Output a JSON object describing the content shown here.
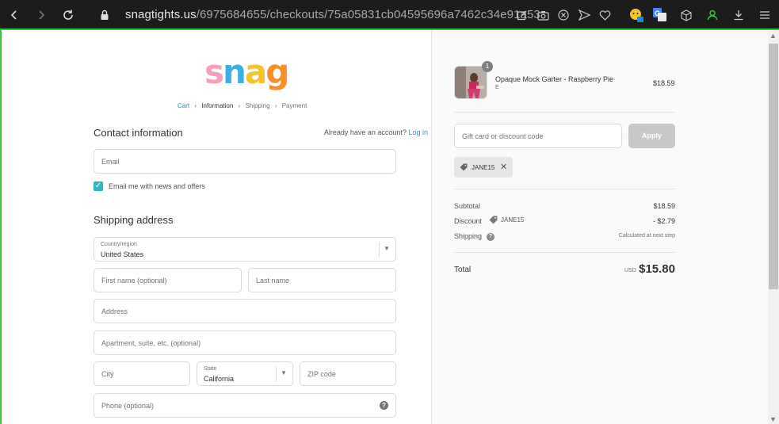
{
  "browser": {
    "url_domain": "snagtights.us",
    "url_path": "/6975684655/checkouts/75a05831cb04595696a7462c34e91a53",
    "extension_badge": "G",
    "accent_color": "#38c936"
  },
  "brand": {
    "logo_text": "snag",
    "logo_colors": [
      "#f59fbd",
      "#3bb0e7",
      "#f7c22b",
      "#f58f2a"
    ]
  },
  "breadcrumb": [
    {
      "label": "Cart",
      "state": "link"
    },
    {
      "label": "Information",
      "state": "current"
    },
    {
      "label": "Shipping",
      "state": "upcoming"
    },
    {
      "label": "Payment",
      "state": "upcoming"
    }
  ],
  "contact": {
    "title": "Contact information",
    "account_prompt": "Already have an account?",
    "login_label": "Log in",
    "email_placeholder": "Email",
    "newsletter_label": "Email me with news and offers",
    "newsletter_checked": true
  },
  "shipping": {
    "title": "Shipping address",
    "country_label": "Country/region",
    "country_value": "United States",
    "first_name_placeholder": "First name (optional)",
    "last_name_placeholder": "Last name",
    "address_placeholder": "Address",
    "apartment_placeholder": "Apartment, suite, etc. (optional)",
    "city_placeholder": "City",
    "state_label": "State",
    "state_value": "California",
    "zip_placeholder": "ZIP code",
    "phone_placeholder": "Phone (optional)"
  },
  "summary": {
    "item": {
      "quantity": "1",
      "name": "Opaque Mock Garter - Raspberry Pie",
      "variant": "E",
      "price": "$18.59"
    },
    "discount_placeholder": "Gift card or discount code",
    "apply_label": "Apply",
    "applied_code": "JANE15",
    "subtotal_label": "Subtotal",
    "subtotal_value": "$18.59",
    "discount_label": "Discount",
    "discount_code": "JANE15",
    "discount_value": "- $2.79",
    "shipping_label": "Shipping",
    "shipping_value": "Calculated at next step",
    "total_label": "Total",
    "currency": "USD",
    "total_value": "$15.80"
  }
}
